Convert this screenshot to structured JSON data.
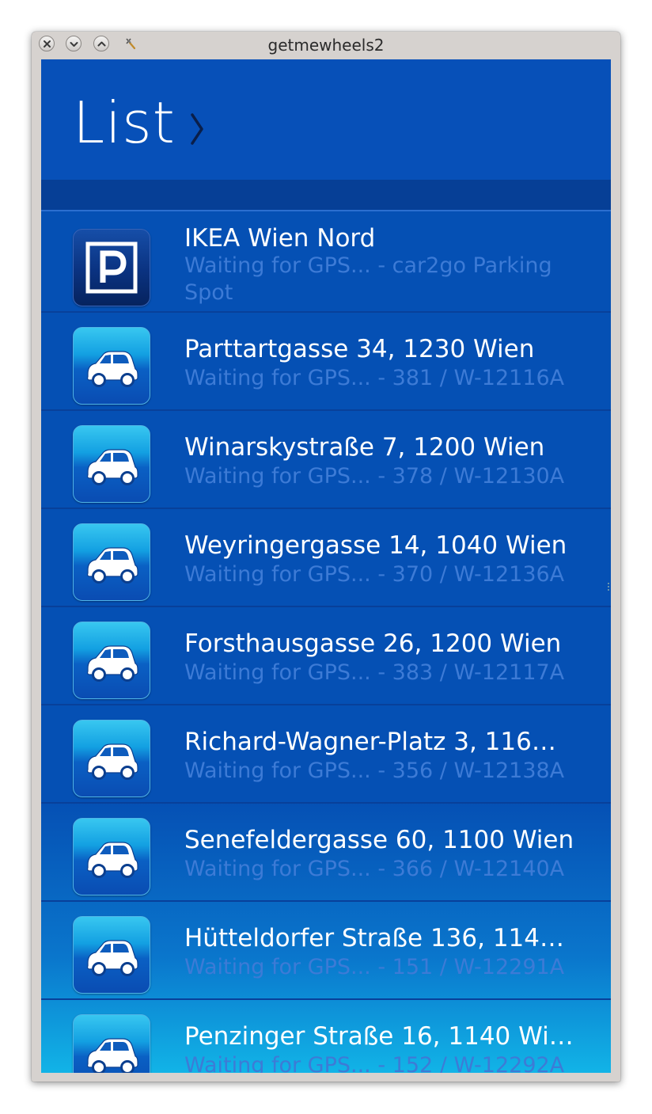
{
  "window": {
    "title": "getmewheels2"
  },
  "header": {
    "title": "List"
  },
  "colors": {
    "header_bg": "#0750b8",
    "list_bg": "#0550b4",
    "subtitle_text": "#3d7bd6",
    "title_text": "#ffffff"
  },
  "items": [
    {
      "icon": "parking-icon",
      "title": "IKEA Wien Nord",
      "subtitle": "Waiting for GPS... - car2go Parking Spot"
    },
    {
      "icon": "car-icon",
      "title": "Parttartgasse 34, 1230 Wien",
      "subtitle": "Waiting for GPS... - 381 / W-12116A"
    },
    {
      "icon": "car-icon",
      "title": "Winarskystraße 7, 1200 Wien",
      "subtitle": "Waiting for GPS... - 378 / W-12130A"
    },
    {
      "icon": "car-icon",
      "title": "Weyringergasse 14, 1040 Wien",
      "subtitle": "Waiting for GPS... - 370 / W-12136A"
    },
    {
      "icon": "car-icon",
      "title": "Forsthausgasse 26, 1200 Wien",
      "subtitle": "Waiting for GPS... - 383 / W-12117A"
    },
    {
      "icon": "car-icon",
      "title": "Richard-Wagner-Platz 3, 116…",
      "subtitle": "Waiting for GPS... - 356 / W-12138A"
    },
    {
      "icon": "car-icon",
      "title": "Senefeldergasse 60, 1100 Wien",
      "subtitle": "Waiting for GPS... - 366 / W-12140A"
    },
    {
      "icon": "car-icon",
      "title": "Hütteldorfer Straße 136, 114…",
      "subtitle": "Waiting for GPS... - 151 / W-12291A"
    },
    {
      "icon": "car-icon",
      "title": "Penzinger Straße 16, 1140 Wi…",
      "subtitle": "Waiting for GPS... - 152 / W-12292A"
    }
  ]
}
